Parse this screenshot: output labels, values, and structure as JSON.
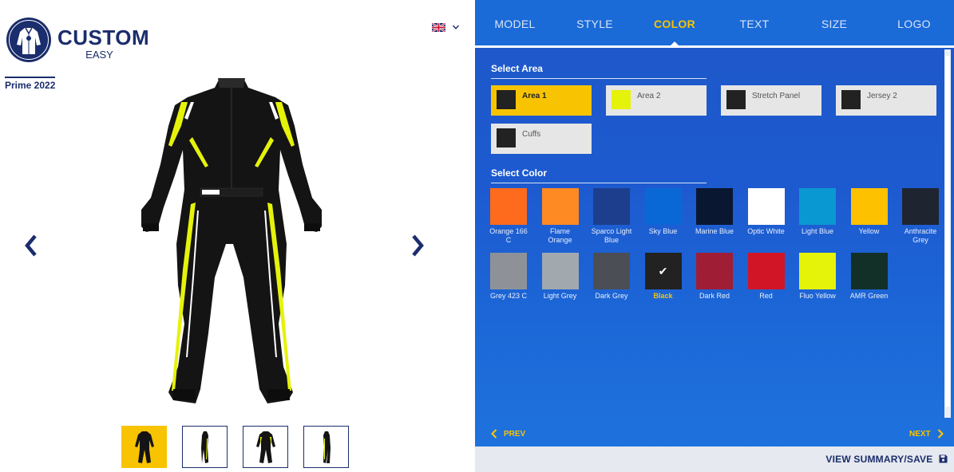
{
  "brand": {
    "logo_text": "CUSTOM",
    "logo_sub": "EASY",
    "model_name": "Prime 2022"
  },
  "language": {
    "flag": "uk-flag-icon"
  },
  "tabs": [
    {
      "label": "MODEL"
    },
    {
      "label": "STYLE"
    },
    {
      "label": "COLOR"
    },
    {
      "label": "TEXT"
    },
    {
      "label": "SIZE"
    },
    {
      "label": "LOGO"
    }
  ],
  "active_tab": "COLOR",
  "select_area": {
    "title": "Select Area",
    "items": [
      {
        "label": "Area 1",
        "color": "#222222",
        "selected": true
      },
      {
        "label": "Area 2",
        "color": "#e5f20a"
      },
      {
        "label": "Stretch Panel",
        "color": "#222222"
      },
      {
        "label": "Jersey 2",
        "color": "#222222"
      },
      {
        "label": "Cuffs",
        "color": "#222222"
      }
    ]
  },
  "select_color": {
    "title": "Select Color",
    "items": [
      {
        "label": "Orange 166 C",
        "color": "#fe6b1d"
      },
      {
        "label": "Flame Orange",
        "color": "#fe8a24"
      },
      {
        "label": "Sparco Light Blue",
        "color": "#1d3e8c"
      },
      {
        "label": "Sky Blue",
        "color": "#0a67d6"
      },
      {
        "label": "Marine Blue",
        "color": "#0a1730"
      },
      {
        "label": "Optic White",
        "color": "#ffffff"
      },
      {
        "label": "Light Blue",
        "color": "#0a98d2"
      },
      {
        "label": "Yellow",
        "color": "#fdc100"
      },
      {
        "label": "Anthracite Grey",
        "color": "#1e2531"
      },
      {
        "label": "Grey 423 C",
        "color": "#8e9298"
      },
      {
        "label": "Light Grey",
        "color": "#a1a8ae"
      },
      {
        "label": "Dark Grey",
        "color": "#4b4e55"
      },
      {
        "label": "Black",
        "color": "#222222",
        "selected": true
      },
      {
        "label": "Dark Red",
        "color": "#a01d36"
      },
      {
        "label": "Red",
        "color": "#d11527"
      },
      {
        "label": "Fluo Yellow",
        "color": "#e5f20a"
      },
      {
        "label": "AMR Green",
        "color": "#133028"
      }
    ]
  },
  "nav": {
    "prev_label": "PREV",
    "next_label": "NEXT"
  },
  "footer": {
    "summary_label": "VIEW SUMMARY/SAVE"
  },
  "colors": {
    "accent": "#f8c401",
    "brand_dark": "#1a2d6c",
    "panel_blue": "#1d5ad0"
  }
}
